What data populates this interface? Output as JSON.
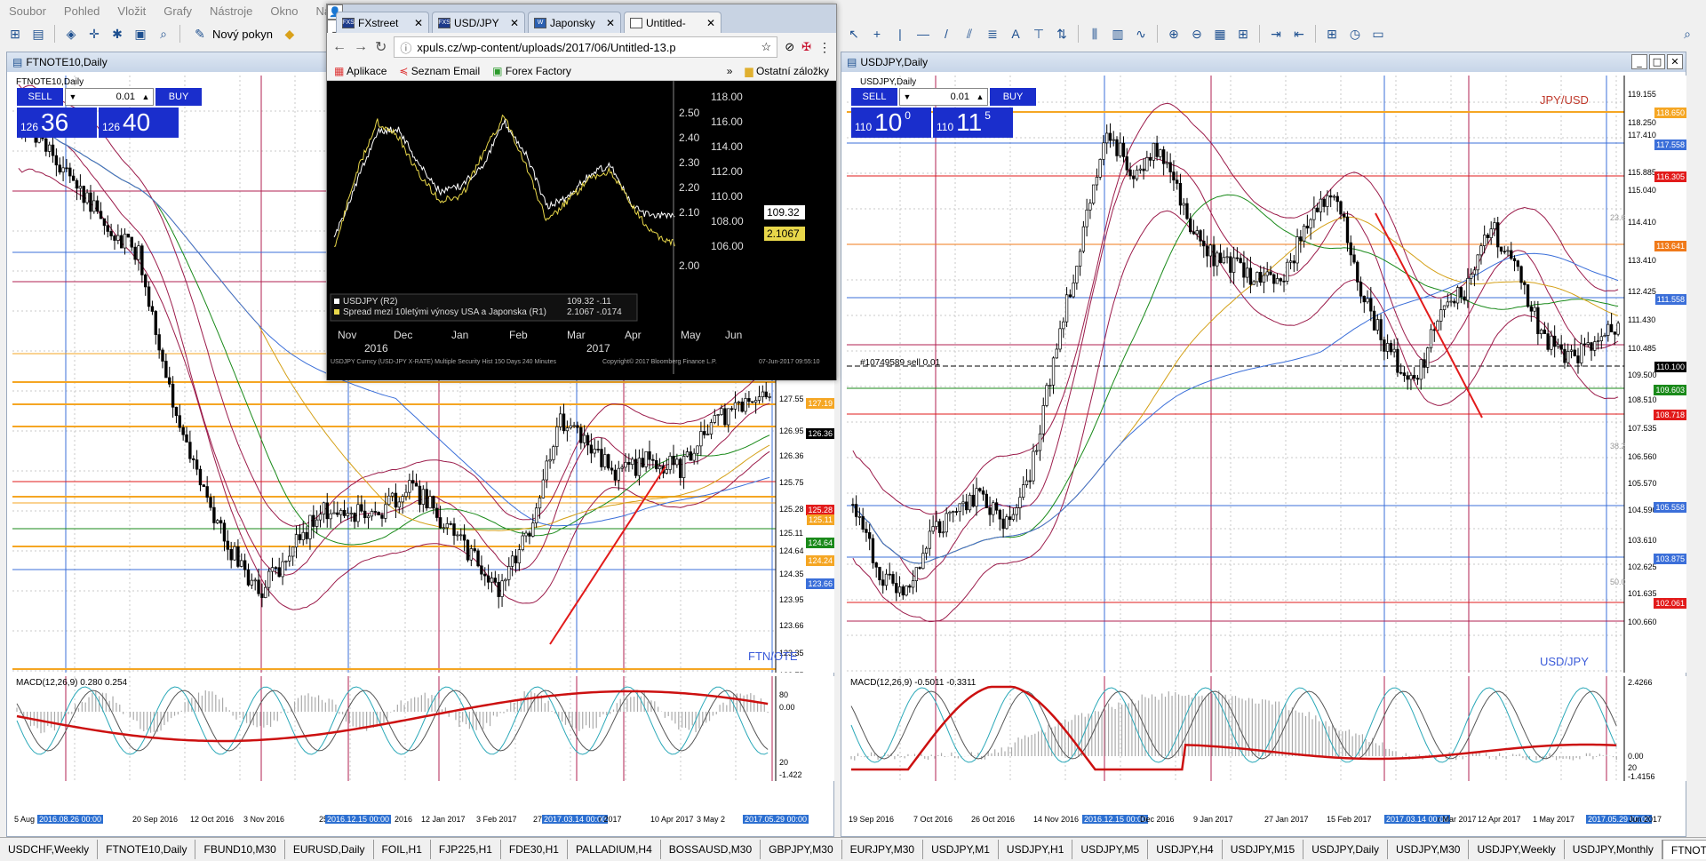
{
  "menu": [
    "Soubor",
    "Pohled",
    "Vložit",
    "Grafy",
    "Nástroje",
    "Okno",
    "Nápověda"
  ],
  "toolbar": {
    "new_order_label": "Nový pokyn"
  },
  "left_window": {
    "title": "FTNOTE10,Daily",
    "symbol_label": "FTNOTE10,Daily",
    "trade": {
      "sell_label": "SELL",
      "buy_label": "BUY",
      "lot": "0.01",
      "sell_small": "126",
      "sell_big": "36",
      "buy_small": "126",
      "buy_big": "40"
    },
    "price_axis": [
      "127.55",
      "126.95",
      "126.36",
      "125.75",
      "125.28",
      "125.11",
      "124.64",
      "124.35",
      "123.95",
      "123.66",
      "123.35",
      "122.75",
      "122.21"
    ],
    "level_labels": [
      {
        "text": "127.19",
        "color": "#f5a623"
      },
      {
        "text": "126.36",
        "color": "#000000"
      },
      {
        "text": "125.28",
        "color": "#e21b1b"
      },
      {
        "text": "125.11",
        "color": "#f5a623"
      },
      {
        "text": "124.64",
        "color": "#1a8a1a"
      },
      {
        "text": "124.24",
        "color": "#f5a623"
      },
      {
        "text": "123.66",
        "color": "#3b6fd9"
      },
      {
        "text": "122.21",
        "color": "#f5a623"
      }
    ],
    "watermark": "FTN/OTE",
    "macd_label": "MACD(12,26,9) 0.280 0.254",
    "macd_axis": [
      "80",
      "0.00",
      "20",
      "-1.422"
    ],
    "dates": [
      "5 Aug",
      "2016.08.26 00:00",
      "20 Sep 2016",
      "12 Oct 2016",
      "3 Nov 2016",
      "25 N",
      "2016.12.15 00:00",
      "2016",
      "12 Jan 2017",
      "3 Feb 2017",
      "27",
      "2017.03.14 00:00",
      "r 2017",
      "10 Apr 2017",
      "3 May 2",
      "2017.05.29 00:00"
    ]
  },
  "right_window": {
    "title": "USDJPY,Daily",
    "symbol_label": "USDJPY,Daily",
    "trade": {
      "sell_label": "SELL",
      "buy_label": "BUY",
      "lot": "0.01",
      "sell_small": "110",
      "sell_big": "10",
      "sell_sup": "0",
      "buy_small": "110",
      "buy_big": "11",
      "buy_sup": "5"
    },
    "price_axis": [
      "119.155",
      "118.250",
      "117.410",
      "115.885",
      "115.040",
      "114.410",
      "113.410",
      "112.425",
      "111.430",
      "110.485",
      "109.500",
      "108.510",
      "107.535",
      "106.560",
      "105.570",
      "104.590",
      "103.610",
      "102.625",
      "101.635",
      "100.660"
    ],
    "level_labels": [
      {
        "text": "118.650",
        "color": "#f5a623"
      },
      {
        "text": "117.558",
        "color": "#3b6fd9"
      },
      {
        "text": "116.305",
        "color": "#e21b1b"
      },
      {
        "text": "113.641",
        "color": "#f07a1a"
      },
      {
        "text": "111.558",
        "color": "#3b6fd9"
      },
      {
        "text": "110.100",
        "color": "#000000"
      },
      {
        "text": "109.603",
        "color": "#1a8a1a"
      },
      {
        "text": "108.718",
        "color": "#e21b1b"
      },
      {
        "text": "105.558",
        "color": "#3b6fd9"
      },
      {
        "text": "103.875",
        "color": "#3b6fd9"
      },
      {
        "text": "102.061",
        "color": "#e21b1b"
      }
    ],
    "fib_labels": [
      "23.6",
      "38.2",
      "50.0"
    ],
    "order_label": "#10749589 sell 0.01",
    "watermark_top": "JPY/USD",
    "watermark": "USD/JPY",
    "macd_label": "MACD(12,26,9) -0.5011 -0.3311",
    "macd_axis": [
      "2.4266",
      "0.00",
      "20",
      "-1.4156"
    ],
    "dates": [
      "19 Sep 2016",
      "7 Oct 2016",
      "26 Oct 2016",
      "14 Nov 2016",
      "2016.12.15 00:00",
      "Dec 2016",
      "9 Jan 2017",
      "27 Jan 2017",
      "15 Feb 2017",
      "2017.03.14 00:00",
      "r Mar 2017",
      "12 Apr 2017",
      "1 May 2017",
      "2017.05.29 00:00",
      "Jun 2017"
    ]
  },
  "browser": {
    "tabs": [
      {
        "label": "FXstreet",
        "favicon": "FXS"
      },
      {
        "label": "USD/JPY",
        "favicon": "FXS"
      },
      {
        "label": "Japonsky",
        "favicon": "W"
      },
      {
        "label": "Untitled-",
        "favicon": ""
      }
    ],
    "url": "xpuls.cz/wp-content/uploads/2017/06/Untitled-13.p",
    "bookmarks": [
      "Aplikace",
      "Seznam Email",
      "Forex Factory",
      "Ostatní záložky"
    ],
    "image": {
      "right_axis": [
        "118.00",
        "116.00",
        "114.00",
        "112.00",
        "110.00",
        "108.00",
        "106.00"
      ],
      "left_axis": [
        "2.50",
        "2.40",
        "2.30",
        "2.20",
        "2.10",
        "2.00"
      ],
      "tag_white": "109.32",
      "tag_yellow": "2.1067",
      "months": [
        "Nov",
        "Dec",
        "Jan",
        "Feb",
        "Mar",
        "Apr",
        "May",
        "Jun"
      ],
      "years": [
        "2016",
        "2017"
      ],
      "legend": [
        {
          "text": "USDJPY (R2)",
          "value": "109.32  -.11",
          "color": "#ffffff"
        },
        {
          "text": "Spread mezi 10letými výnosy USA a Japonska (R1)",
          "value": "2.1067  -.0174",
          "color": "#e8d74a"
        }
      ],
      "footer_left": "USDJPY Curncy (USD-JPY X-RATE) Multiple Security Hist    150 Days 240 Minutes",
      "footer_mid": "Copyright© 2017 Bloomberg Finance L.P.",
      "footer_right": "07-Jun-2017 09:55:10"
    }
  },
  "bottom_tabs": [
    "USDCHF,Weekly",
    "FTNOTE10,Daily",
    "FBUND10,M30",
    "EURUSD,Daily",
    "FOIL,H1",
    "FJP225,H1",
    "FDE30,H1",
    "PALLADIUM,H4",
    "BOSSAUSD,M30",
    "GBPJPY,M30",
    "EURJPY,M30",
    "USDJPY,M1",
    "USDJPY,H1",
    "USDJPY,M5",
    "USDJPY,H4",
    "USDJPY,M15",
    "USDJPY,Daily",
    "USDJPY,M30",
    "USDJPY,Weekly",
    "USDJPY,Monthly",
    "FTNOTE"
  ],
  "active_bottom_tab": "FTNOTE"
}
